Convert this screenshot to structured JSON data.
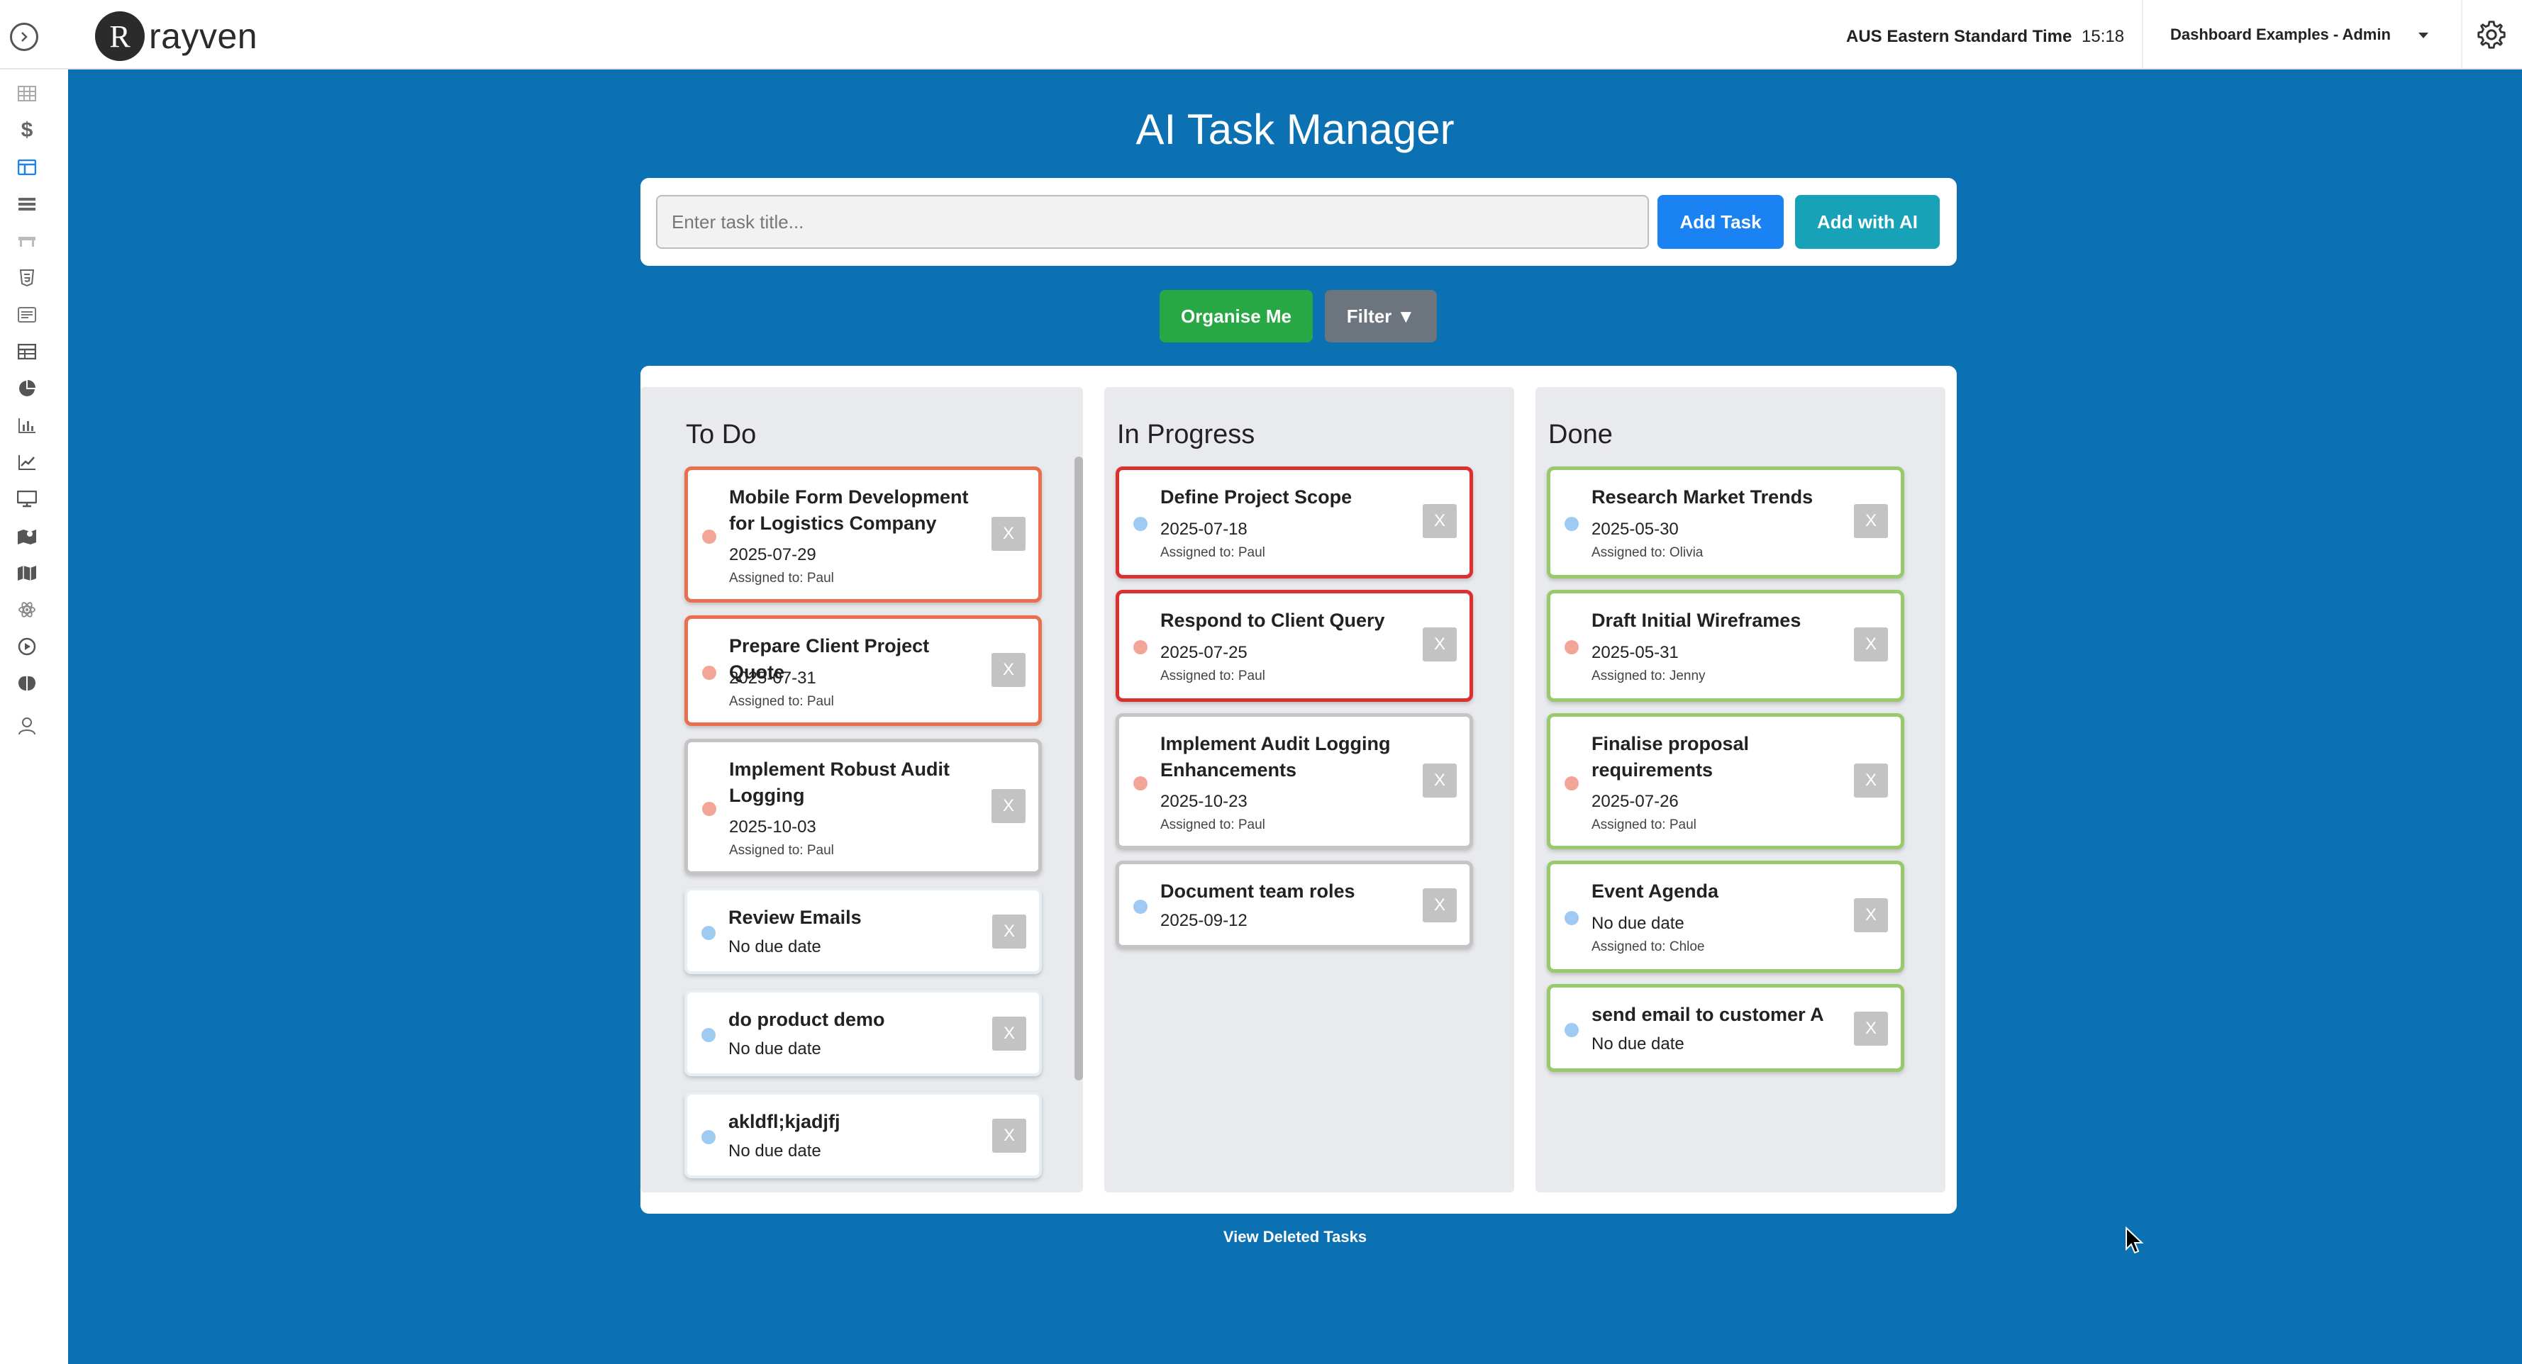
{
  "header": {
    "logo_text": "rayven",
    "logo_letter": "R",
    "timezone_label": "AUS Eastern Standard Time",
    "time": "15:18",
    "dashboard_select": "Dashboard Examples - Admin"
  },
  "sidebar": {
    "icons": [
      "grid-icon",
      "dollar-icon",
      "dashboard-icon",
      "list-icon",
      "bench-icon",
      "html-icon",
      "document-icon",
      "table-icon",
      "pie-chart-icon",
      "bar-chart-icon",
      "line-chart-icon",
      "monitor-icon",
      "map-pin-icon",
      "map-icon",
      "atom-icon",
      "play-icon",
      "brain-icon",
      "user-icon"
    ],
    "active_icon": "dashboard-icon",
    "active_color": "#1a82f2"
  },
  "app": {
    "title": "AI Task Manager",
    "input_placeholder": "Enter task title...",
    "add_task_label": "Add Task",
    "add_ai_label": "Add with AI",
    "organise_label": "Organise Me",
    "filter_label": "Filter ▼",
    "view_deleted_label": "View Deleted Tasks",
    "delete_label": "X"
  },
  "columns": [
    {
      "title": "To Do",
      "cards": [
        {
          "title": "Mobile Form Development for Logistics Company",
          "date": "2025-07-29",
          "assigned": "Assigned to: Paul"
        },
        {
          "title": "Prepare Client Project Quote",
          "date": "2025-07-31",
          "assigned": "Assigned to: Paul"
        },
        {
          "title": "Implement Robust Audit Logging",
          "date": "2025-10-03",
          "assigned": "Assigned to: Paul"
        },
        {
          "title": "Review Emails",
          "date": "No due date"
        },
        {
          "title": "do product demo",
          "date": "No due date"
        },
        {
          "title": "akldfl;kjadjfj",
          "date": "No due date"
        }
      ]
    },
    {
      "title": "In Progress",
      "cards": [
        {
          "title": "Define Project Scope",
          "date": "2025-07-18",
          "assigned": "Assigned to: Paul"
        },
        {
          "title": "Respond to Client Query",
          "date": "2025-07-25",
          "assigned": "Assigned to: Paul"
        },
        {
          "title": "Implement Audit Logging Enhancements",
          "date": "2025-10-23",
          "assigned": "Assigned to: Paul"
        },
        {
          "title": "Document team roles",
          "date": "2025-09-12"
        }
      ]
    },
    {
      "title": "Done",
      "cards": [
        {
          "title": "Research Market Trends",
          "date": "2025-05-30",
          "assigned": "Assigned to: Olivia"
        },
        {
          "title": "Draft Initial Wireframes",
          "date": "2025-05-31",
          "assigned": "Assigned to: Jenny"
        },
        {
          "title": "Finalise proposal requirements",
          "date": "2025-07-26",
          "assigned": "Assigned to: Paul"
        },
        {
          "title": "Event Agenda",
          "date": "No due date",
          "assigned": "Assigned to: Chloe"
        },
        {
          "title": "send email to customer A",
          "date": "No due date"
        }
      ]
    }
  ],
  "colors": {
    "main_bg": "#0c71b3",
    "urgent_border": "#dc2f2f",
    "high_border": "#ea6f50",
    "done_border": "#98c96a",
    "priority_dot": "#f3a597",
    "normal_dot": "#9fcaf1"
  }
}
